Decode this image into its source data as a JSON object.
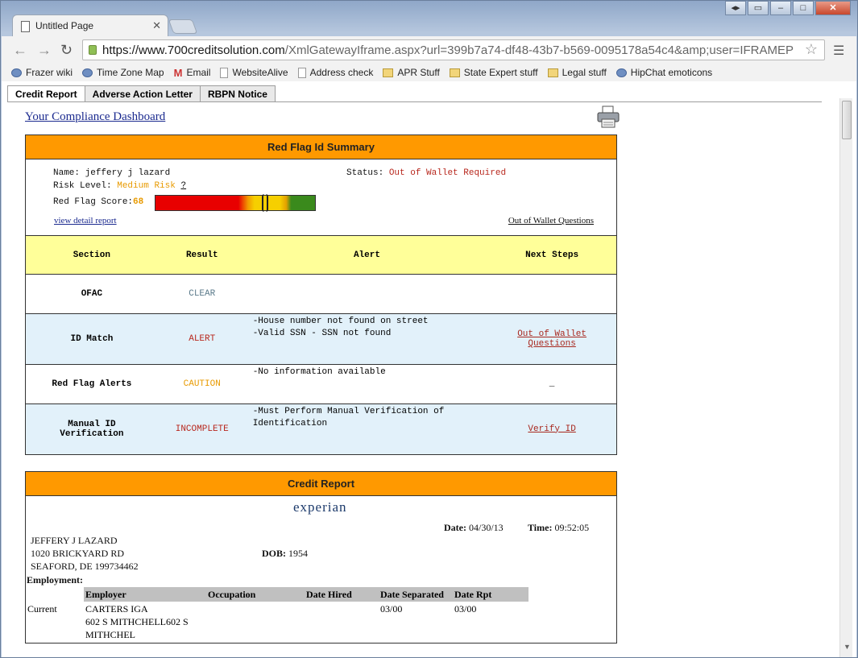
{
  "browser": {
    "tab_title": "Untitled Page",
    "url_host": "https://www.700creditsolution.com",
    "url_path": "/XmlGatewayIframe.aspx?url=399b7a74-df48-43b7-b569-0095178a54c4&amp;user=IFRAMEP",
    "bookmarks": [
      "Frazer wiki",
      "Time Zone Map",
      "Email",
      "WebsiteAlive",
      "Address check",
      "APR Stuff",
      "State Expert stuff",
      "Legal stuff",
      "HipChat emoticons"
    ]
  },
  "app_tabs": [
    "Credit Report",
    "Adverse Action Letter",
    "RBPN Notice"
  ],
  "dashboard_link": "Your Compliance Dashboard",
  "red_flag": {
    "title": "Red Flag Id Summary",
    "name_label": "Name:",
    "name": "jeffery j lazard",
    "status_label": "Status:",
    "status": "Out of Wallet Required",
    "risk_label": "Risk Level:",
    "risk": "Medium Risk",
    "risk_help": "?",
    "score_label": "Red Flag Score:",
    "score": "68",
    "score_value": 68,
    "detail_link": "view detail report",
    "oow_link": "Out of Wallet Questions",
    "headers": [
      "Section",
      "Result",
      "Alert",
      "Next Steps"
    ],
    "rows": [
      {
        "section": "OFAC",
        "result": "CLEAR",
        "alert": "",
        "next": ""
      },
      {
        "section": "ID Match",
        "result": "ALERT",
        "alert": "-House number not found on street\n-Valid SSN - SSN not found",
        "next": "Out of Wallet\nQuestions"
      },
      {
        "section": "Red Flag Alerts",
        "result": "CAUTION",
        "alert": "-No information available",
        "next": "_"
      },
      {
        "section": "Manual ID\nVerification",
        "result": "INCOMPLETE",
        "alert": "-Must Perform Manual Verification of\n Identification",
        "next": "Verify ID"
      }
    ]
  },
  "credit": {
    "title": "Credit Report",
    "bureau": "experian",
    "date_label": "Date:",
    "date": "04/30/13",
    "time_label": "Time:",
    "time": "09:52:05",
    "name": "JEFFERY J LAZARD",
    "addr1": "1020 BRICKYARD RD",
    "addr2": "SEAFORD, DE  199734462",
    "dob_label": "DOB:",
    "dob": "1954",
    "employment_label": "Employment:",
    "emp_headers": [
      "Employer",
      "Occupation",
      "Date Hired",
      "Date Separated",
      "Date Rpt"
    ],
    "emp_row": {
      "status": "Current",
      "employer": "CARTERS IGA\n602 S MITHCHELL602 S\nMITHCHEL",
      "occupation": "",
      "hired": "",
      "separated": "03/00",
      "rpt": "03/00"
    }
  },
  "colors": {
    "accent": "#ff9900",
    "header_yellow": "#ffff99",
    "row_blue": "#e2f1fa",
    "alert_red": "#b8281e",
    "caution": "#e89a00",
    "clear": "#5b7a8a"
  }
}
